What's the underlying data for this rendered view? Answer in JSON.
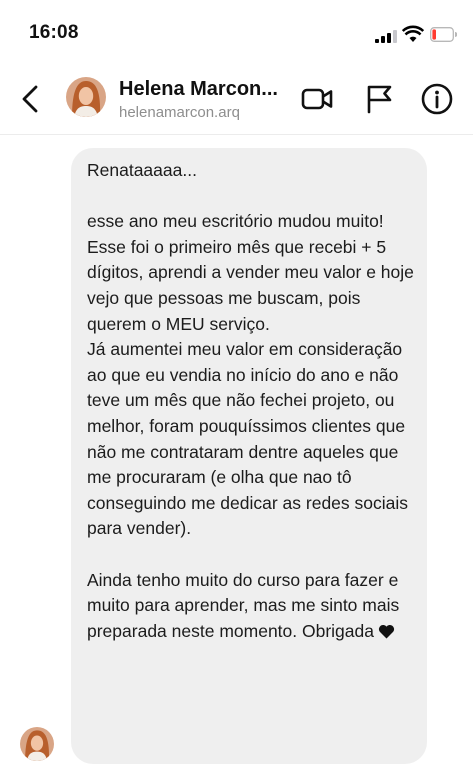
{
  "status_bar": {
    "time": "16:08"
  },
  "header": {
    "name": "Helena Marcon...",
    "username": "helenamarcon.arq",
    "icons": [
      "back-icon",
      "video-call-icon",
      "flag-icon",
      "info-icon"
    ]
  },
  "message": {
    "text": "Renataaaaa...\n\nesse ano meu escritório mudou muito! Esse foi o primeiro mês que recebi + 5 dígitos, aprendi a vender meu valor e hoje vejo que pessoas me buscam, pois querem o MEU serviço.\nJá aumentei meu valor em consideração ao que eu vendia no início do ano e não teve um mês que não fechei projeto, ou melhor, foram pouquíssimos clientes que não me contrataram dentre aqueles que me procuraram (e olha que nao tô conseguindo me dedicar as redes sociais para vender).\n\nAinda tenho muito do curso para fazer e muito para aprender, mas me sinto mais preparada neste momento. Obrigada",
    "emoji": "heart-icon"
  },
  "colors": {
    "bubble": "#efefef",
    "username": "#8e8e8e",
    "battery_low": "#ff3b30"
  }
}
